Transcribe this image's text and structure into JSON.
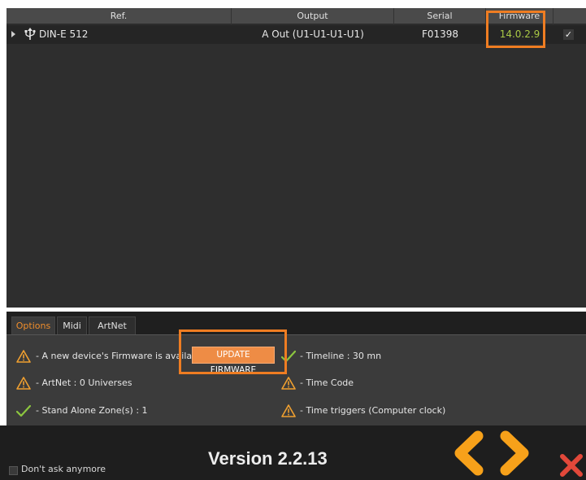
{
  "table": {
    "headers": {
      "ref": "Ref.",
      "output": "Output",
      "serial": "Serial",
      "firmware": "Firmware"
    },
    "rows": [
      {
        "ref": "DIN-E 512",
        "output": "A Out (U1-U1-U1-U1)",
        "serial": "F01398",
        "firmware": "14.0.2.9",
        "checked": true,
        "check_glyph": "✓"
      }
    ]
  },
  "tabs": [
    {
      "label": "Options",
      "active": true
    },
    {
      "label": "Midi",
      "active": false
    },
    {
      "label": "ArtNet",
      "active": false
    }
  ],
  "options": {
    "firmware_notice": "- A new device's Firmware is available",
    "update_button": "UPDATE FIRMWARE",
    "artnet": "- ArtNet : 0 Universes",
    "standalone": "- Stand Alone Zone(s) : 1",
    "timeline": "- Timeline : 30 mn",
    "timecode": "- Time Code",
    "time_triggers": "- Time triggers (Computer clock)"
  },
  "footer": {
    "dont_ask": "Don't ask anymore",
    "version": "Version 2.2.13"
  },
  "icons": {
    "warning": "warning-icon",
    "ok": "checkmark-icon",
    "usb": "usb-icon",
    "prev": "chevron-left-icon",
    "next": "chevron-right-icon",
    "close": "close-icon"
  },
  "colors": {
    "accent": "#ef7d22",
    "firmware_text": "#a9c845",
    "ok_green": "#8cc63f",
    "close_red": "#e2483a"
  }
}
